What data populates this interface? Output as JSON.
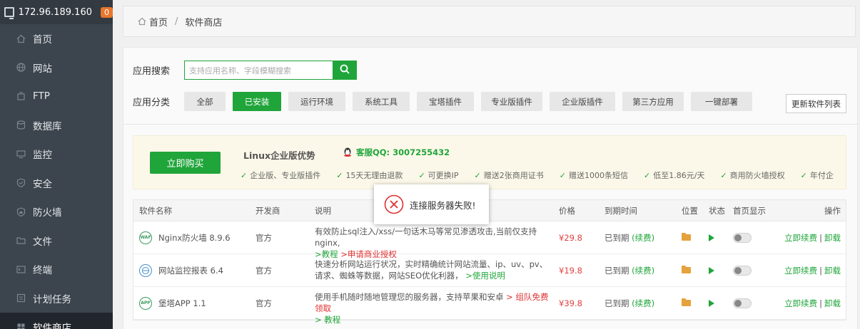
{
  "sidebar": {
    "server_ip": "172.96.189.160",
    "badge": "0",
    "items": [
      {
        "label": "首页",
        "icon": "home-icon"
      },
      {
        "label": "网站",
        "icon": "globe-icon"
      },
      {
        "label": "FTP",
        "icon": "ftp-icon"
      },
      {
        "label": "数据库",
        "icon": "database-icon"
      },
      {
        "label": "监控",
        "icon": "monitor-icon"
      },
      {
        "label": "安全",
        "icon": "shield-icon"
      },
      {
        "label": "防火墙",
        "icon": "firewall-icon"
      },
      {
        "label": "文件",
        "icon": "folder-icon"
      },
      {
        "label": "终端",
        "icon": "terminal-icon"
      },
      {
        "label": "计划任务",
        "icon": "clock-icon"
      },
      {
        "label": "软件商店",
        "icon": "store-icon"
      }
    ]
  },
  "breadcrumb": {
    "home": "首页",
    "separator": "/",
    "current": "软件商店"
  },
  "search": {
    "label": "应用搜索",
    "placeholder": "支持应用名称、字段模糊搜索"
  },
  "categories": {
    "label": "应用分类",
    "items": [
      "全部",
      "已安装",
      "运行环境",
      "系统工具",
      "宝塔插件",
      "专业版插件",
      "企业版插件",
      "第三方应用",
      "一键部署"
    ],
    "active": "已安装",
    "refresh": "更新软件列表"
  },
  "promo": {
    "buy": "立即购买",
    "title": "Linux企业版优势",
    "qq": "客服QQ: 3007255432",
    "features": [
      "企业版、专业版插件",
      "15天无理由退款",
      "可更换IP",
      "赠送2张商用证书",
      "赠送1000条短信",
      "低至1.86元/天",
      "商用防火墙授权",
      "年付企"
    ]
  },
  "table": {
    "headers": {
      "name": "软件名称",
      "dev": "开发商",
      "desc": "说明",
      "price": "价格",
      "expiry": "到期时间",
      "pos": "位置",
      "status": "状态",
      "home": "首页显示",
      "op": "操作"
    },
    "rows": [
      {
        "name": "Nginx防火墙 8.9.6",
        "icon": "WAF",
        "dev": "官方",
        "desc": "有效防止sql注入/xss/一句话木马等常见渗透攻击,当前仅支持nginx,",
        "link1": ">教程",
        "link2": ">申请商业授权",
        "price": "¥29.8",
        "expiry": "已到期",
        "renew": "(续费)",
        "op1": "立即续费",
        "op2": "卸载"
      },
      {
        "name": "网站监控报表 6.4",
        "icon": "",
        "dev": "官方",
        "desc": "快速分析网站运行状况，实时精确统计网站流量、ip、uv、pv、请求、蜘蛛等数据，网站SEO优化利器，",
        "link1": ">使用说明",
        "link2": "",
        "price": "¥19.8",
        "expiry": "已到期",
        "renew": "(续费)",
        "op1": "立即续费",
        "op2": "卸载"
      },
      {
        "name": "堡塔APP 1.1",
        "icon": "APP",
        "dev": "官方",
        "desc": "使用手机随时随地管理您的服务器，支持苹果和安卓",
        "link1": "> 组队免费领取",
        "link2": "> 教程",
        "price": "¥39.8",
        "expiry": "已到期",
        "renew": "(续费)",
        "op1": "立即续费",
        "op2": "卸载"
      }
    ]
  },
  "dialog": {
    "message": "连接服务器失败!"
  },
  "colors": {
    "accent": "#20a53a",
    "sidebar": "#3c444d",
    "price": "#e04040",
    "error": "#e03030"
  }
}
